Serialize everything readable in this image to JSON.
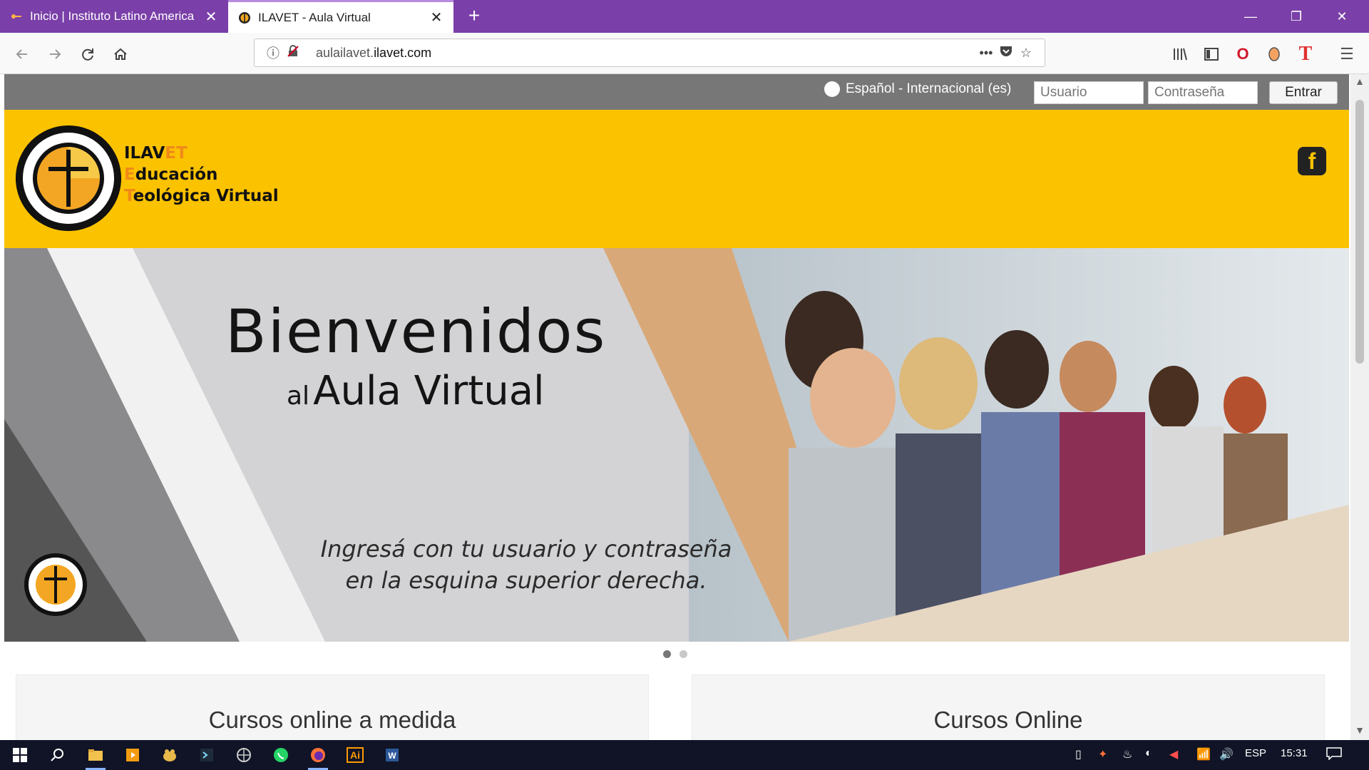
{
  "browser": {
    "tabs": [
      {
        "title": "Inicio | Instituto Latino America",
        "active": false
      },
      {
        "title": "ILAVET - Aula Virtual",
        "active": true
      }
    ],
    "new_tab": "+",
    "url_host": "aulailavet.",
    "url_domain": "ilavet.com",
    "window_controls": [
      "minimize",
      "restore",
      "close"
    ]
  },
  "page": {
    "language": "Español - Internacional (es)",
    "username_placeholder": "Usuario",
    "password_placeholder": "Contraseña",
    "login_button": "Entrar",
    "brand": {
      "line1_a": "ILAV",
      "line1_b": "ET",
      "line2_a": "E",
      "line2_b": "ducación",
      "line3_a": "T",
      "line3_b": "eológica Virtual"
    },
    "banner": {
      "welcome": "Bienvenidos",
      "al": "al",
      "aula": "Aula Virtual",
      "tagline_line1": "Ingresá con tu usuario y contraseña",
      "tagline_line2": "en la esquina superior derecha."
    },
    "carousel_dots": 2,
    "cards": [
      "Cursos online a medida",
      "Cursos Online"
    ]
  },
  "taskbar": {
    "language": "ESP",
    "time": "15:31"
  },
  "colors": {
    "tabstrip": "#7a3fa8",
    "login_bar": "#777777",
    "header": "#fbc200",
    "brand_orange": "#ef8a17"
  },
  "icons": {
    "nav": [
      "back-icon",
      "forward-icon",
      "reload-icon",
      "home-icon"
    ],
    "toolbar": [
      "library-icon",
      "sidebar-icon",
      "opera-icon",
      "extension-icon",
      "translate-icon",
      "menu-icon"
    ],
    "taskbar_apps": [
      "windows-icon",
      "search-icon",
      "file-explorer-icon",
      "media-player-icon",
      "app-icon",
      "terminal-icon",
      "browser-icon",
      "whatsapp-icon",
      "firefox-icon",
      "illustrator-icon",
      "word-icon"
    ]
  }
}
